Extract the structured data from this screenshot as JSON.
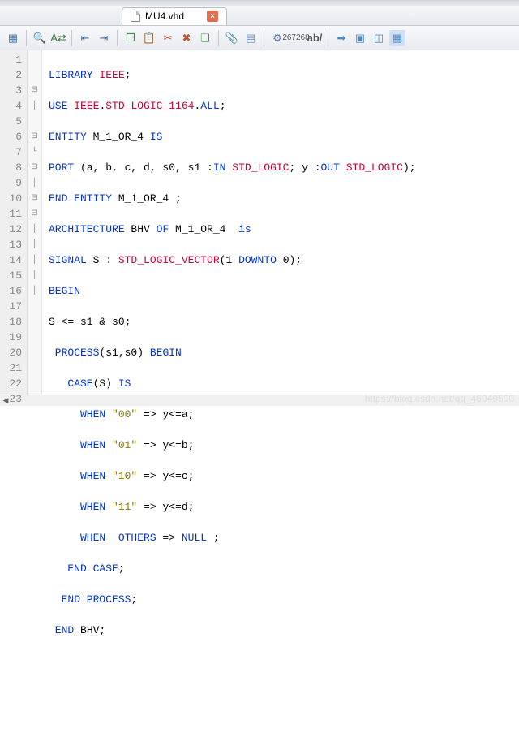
{
  "tab": {
    "title": "MU4.vhd"
  },
  "toolbar": {
    "ratio_top": "267",
    "ratio_bot": "268"
  },
  "gutter": [
    "1",
    "2",
    "3",
    "4",
    "5",
    "6",
    "7",
    "8",
    "9",
    "10",
    "11",
    "12",
    "13",
    "14",
    "15",
    "16",
    "17",
    "18",
    "19",
    "20",
    "21",
    "22",
    "23"
  ],
  "fold": [
    "",
    "",
    "⊟",
    "│",
    "",
    "⊟",
    "└",
    "⊟",
    "│",
    "⊟",
    "⊟",
    "│",
    "│",
    "│",
    "│",
    "│",
    "",
    "",
    "",
    "",
    "",
    "",
    ""
  ],
  "code": {
    "l1": {
      "a": "LIBRARY ",
      "b": "IEEE",
      "c": ";"
    },
    "l2": {
      "a": "USE ",
      "b": "IEEE",
      "c": ".",
      "d": "STD_LOGIC_1164",
      "e": ".",
      "f": "ALL",
      "g": ";"
    },
    "l3": {
      "a": "ENTITY",
      "b": " M_1_OR_4 ",
      "c": "IS"
    },
    "l4": {
      "a": "PORT",
      "b": " (a, b, c, d, s0, s1 :",
      "c": "IN ",
      "d": "STD_LOGIC",
      "e": "; y :",
      "f": "OUT ",
      "g": "STD_LOGIC",
      "h": ");"
    },
    "l5": {
      "a": "END ENTITY",
      "b": " M_1_OR_4 ;"
    },
    "l6": {
      "a": "ARCHITECTURE",
      "b": " BHV ",
      "c": "OF",
      "d": " M_1_OR_4  ",
      "e": "is"
    },
    "l7": {
      "a": "SIGNAL",
      "b": " S : ",
      "c": "STD_LOGIC_VECTOR",
      "d": "(",
      "e": "1 ",
      "f": "DOWNTO ",
      "g": "0",
      ") ": ");",
      "h": ");"
    },
    "l8": {
      "a": "BEGIN"
    },
    "l9": {
      "a": "S <= s1 & s0;"
    },
    "l10": {
      "a": " PROCESS",
      "b": "(s1,s0) ",
      "c": "BEGIN"
    },
    "l11": {
      "a": "   CASE",
      "b": "(S) ",
      "c": "IS"
    },
    "l12": {
      "a": "     WHEN ",
      "b": "\"00\"",
      "c": " => y<=a;"
    },
    "l13": {
      "a": "     WHEN ",
      "b": "\"01\"",
      "c": " => y<=b;"
    },
    "l14": {
      "a": "     WHEN ",
      "b": "\"10\"",
      "c": " => y<=c;"
    },
    "l15": {
      "a": "     WHEN ",
      "b": "\"11\"",
      "c": " => y<=d;"
    },
    "l16": {
      "a": "     WHEN  OTHERS",
      "b": " => ",
      "c": "NULL",
      "d": " ;"
    },
    "l17": {
      "a": "   END CASE",
      ";": ";"
    },
    "l18": {
      "a": "  END PROCESS",
      ";": ";"
    },
    "l19": {
      "a": " END",
      "b": " BHV;"
    }
  },
  "watermark": "https://blog.csdn.net/qq_46049500"
}
